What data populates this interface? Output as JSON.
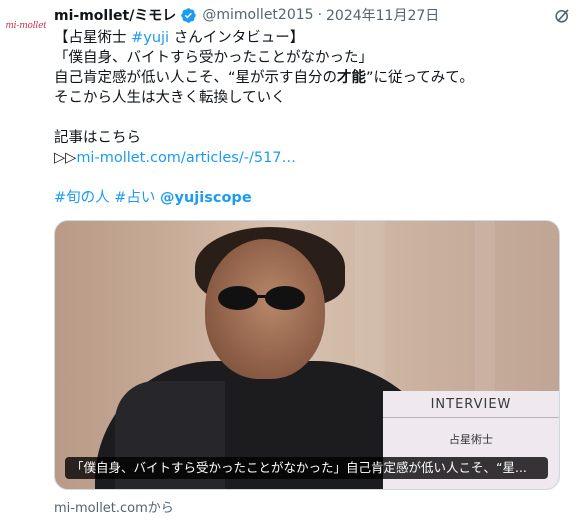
{
  "avatar": {
    "logo_text": "mi-mollet"
  },
  "header": {
    "name": "mi-mollet/ミモレ",
    "handle": "@mimollet2015",
    "separator": "·",
    "date": "2024年11月27日"
  },
  "body": {
    "line1_prefix": "【占星術士 ",
    "line1_hashtag": "#yuji",
    "line1_suffix": " さんインタビュー】",
    "line2": "「僕自身、バイトすら受かったことがなかった」",
    "line3_prefix": "自己肯定感が低い人こそ、“星が示す自分の",
    "line3_bold": "才能",
    "line3_suffix": "”に従ってみて。",
    "line4": "そこから人生は大きく転換していく",
    "line5": "記事はこちら",
    "line6_prefix": "▷▷",
    "line6_link": "mi-mollet.com/articles/-/517…",
    "tag1": "#旬の人",
    "tag2": "#占い",
    "mention": "@yujiscope"
  },
  "card": {
    "panel_title": "INTERVIEW",
    "panel_sub": "占星術士",
    "caption": "「僕自身、バイトすら受かったことがなかった」自己肯定感が低い人こそ、“星..."
  },
  "source": "mi-mollet.comから",
  "colors": {
    "link": "#1d9bf0",
    "muted": "#536471",
    "verified": "#1d9bf0",
    "brand": "#c8324a"
  },
  "icons": [
    "verified-badge-icon",
    "grok-icon",
    "more-icon"
  ]
}
